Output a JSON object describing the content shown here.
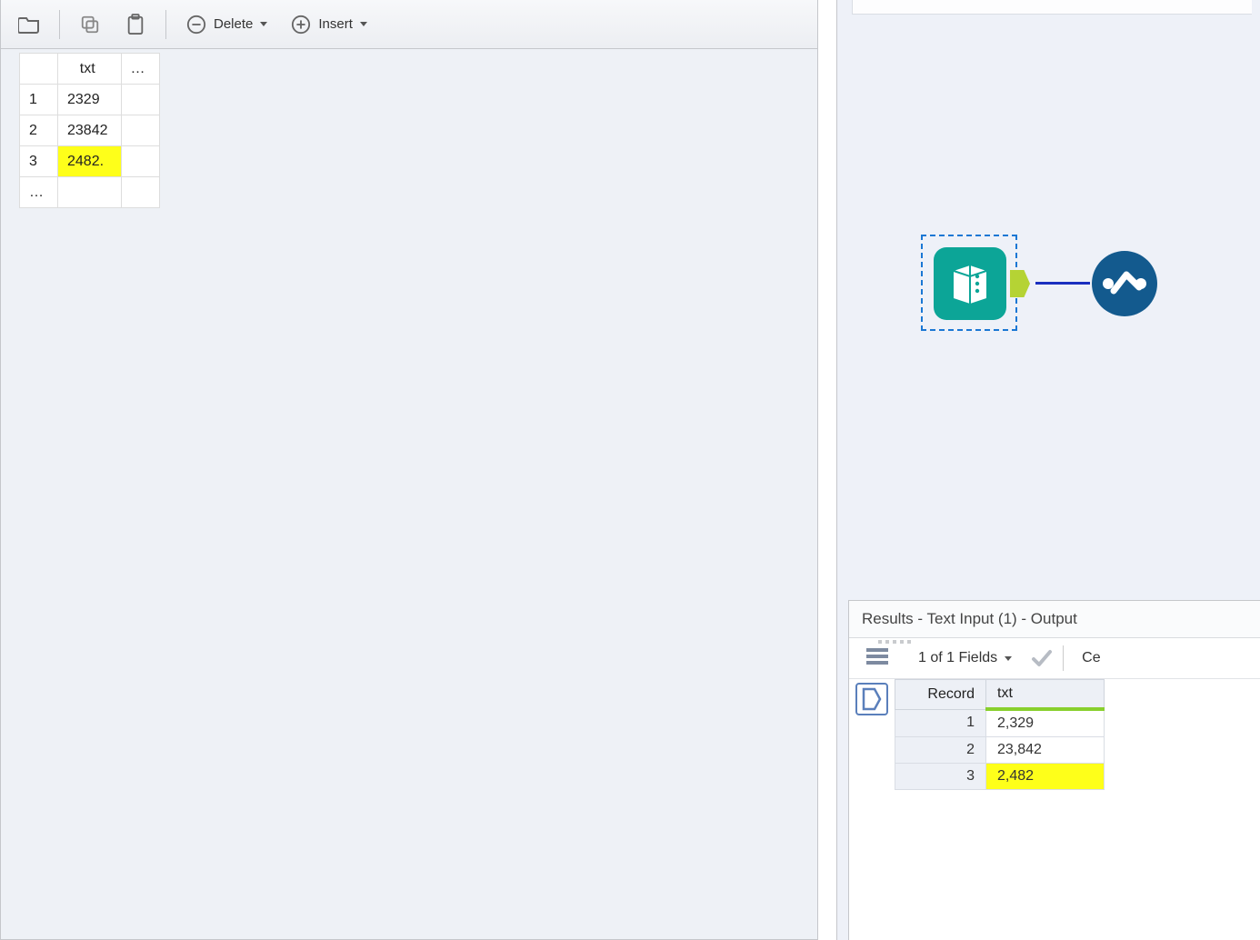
{
  "toolbar": {
    "delete_label": "Delete",
    "insert_label": "Insert"
  },
  "input_grid": {
    "header": "txt",
    "rows": [
      {
        "n": "1",
        "v": "2329",
        "hl": false
      },
      {
        "n": "2",
        "v": "23842",
        "hl": false
      },
      {
        "n": "3",
        "v": "2482.",
        "hl": true
      }
    ]
  },
  "results": {
    "title": "Results - Text Input (1) - Output",
    "fields_label": "1 of 1 Fields",
    "right_label": "Ce",
    "col_record": "Record",
    "col_txt": "txt",
    "rows": [
      {
        "n": "1",
        "v": "2,329",
        "hl": false
      },
      {
        "n": "2",
        "v": "23,842",
        "hl": false
      },
      {
        "n": "3",
        "v": "2,482",
        "hl": true
      }
    ]
  }
}
